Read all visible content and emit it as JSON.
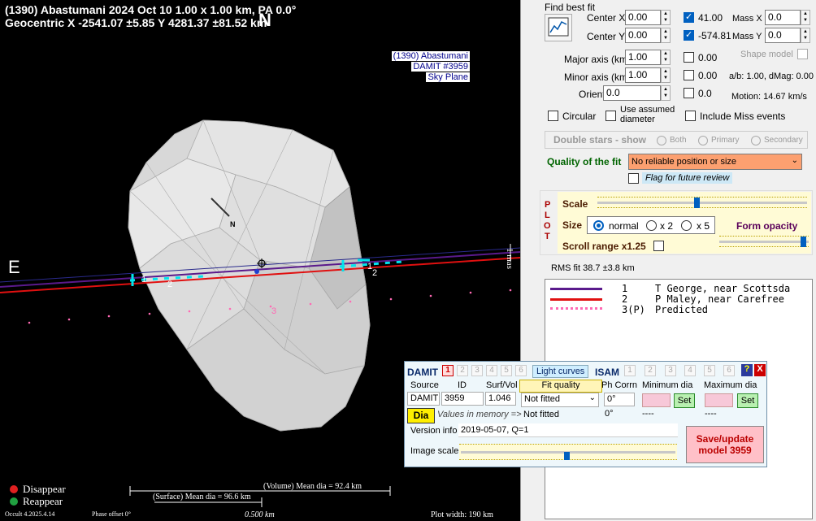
{
  "plot": {
    "title_line1": "(1390) Abastumani  2024 Oct 10  1.00 x 1.00 km, PA 0.0°",
    "title_line2": "Geocentric  X  -2541.07 ±5.85  Y 4281.37 ±81.52 km",
    "north_label": "N",
    "east_label": "E",
    "asteroid_north_label": "N",
    "info_box": [
      "(1390) Abastumani",
      "DAMIT #3959",
      "Sky Plane"
    ],
    "mas_label": "1 mas",
    "chord_labels": [
      "2",
      "2",
      "1",
      "1",
      "3"
    ],
    "legend_disappear": "Disappear",
    "legend_reappear": "Reappear",
    "version": "Occult 4.2025.4.14",
    "phase_offset": "Phase offset 0°",
    "volume_mean": "(Volume) Mean dia = 92.4 km",
    "surface_mean": "(Surface) Mean dia = 96.6 km",
    "scale_bar": "0.500 km",
    "plot_width": "Plot width: 190 km",
    "colors": {
      "disappear": "#e02020",
      "reappear": "#20a040",
      "chord1": "#5a1a8c",
      "chord2": "#e01010",
      "chord3": "#ff69b4",
      "cyan": "#00e5ee"
    }
  },
  "panel": {
    "find_best_fit": "Find best fit",
    "center_x_label": "Center X",
    "center_x_value": "0.00",
    "center_x_fit_value": "41.00",
    "center_y_label": "Center Y",
    "center_y_value": "0.00",
    "center_y_fit_value": "-574.81",
    "mass_x_label": "Mass X",
    "mass_x_value": "0.0",
    "mass_y_label": "Mass Y",
    "mass_y_value": "0.0",
    "shape_model_label": "Shape model",
    "major_axis_label": "Major axis (km)",
    "major_axis_value": "1.00",
    "major_axis_fit": "0.00",
    "minor_axis_label": "Minor axis (km)",
    "minor_axis_value": "1.00",
    "minor_axis_fit": "0.00",
    "ab_dmag": "a/b: 1.00, dMag: 0.00",
    "orientation_label": "Orientation",
    "orientation_value": "0.0",
    "orientation_fit": "0.0",
    "motion": "Motion: 14.67 km/s",
    "circular_label": "Circular",
    "use_assumed_label": "Use assumed diameter",
    "include_miss_label": "Include Miss events",
    "double_stars_label": "Double stars - show",
    "radio_both": "Both",
    "radio_primary": "Primary",
    "radio_secondary": "Secondary",
    "quality_label": "Quality of the fit",
    "quality_value": "No reliable position or size",
    "flag_review_label": "Flag for future review",
    "plot_vertical": [
      "P",
      "L",
      "O",
      "T"
    ],
    "scale_label": "Scale",
    "size_label": "Size",
    "size_normal": "normal",
    "size_x2": "x 2",
    "size_x5": "x 5",
    "form_opacity_label": "Form opacity",
    "scroll_range_label": "Scroll range x1.25",
    "rms_fit": "RMS fit 38.7 ±3.8 km",
    "observers": [
      {
        "num": "1",
        "text": "T George, near Scottsda"
      },
      {
        "num": "2",
        "text": "P Maley, near Carefree"
      },
      {
        "num": "3(P)",
        "text": "Predicted"
      }
    ]
  },
  "damit": {
    "title": "DAMIT",
    "tabs": [
      "1",
      "2",
      "3",
      "4",
      "5",
      "6"
    ],
    "light_curves": "Light curves",
    "isam": "ISAM",
    "isam_tabs": [
      "1",
      "2",
      "3",
      "4",
      "5",
      "6"
    ],
    "help": "?",
    "close": "X",
    "source_label": "Source",
    "id_label": "ID",
    "surf_vol_label": "Surf/Vol",
    "fit_quality_label": "Fit quality",
    "ph_corrn_label": "Ph Corrn",
    "min_dia_label": "Minimum dia",
    "max_dia_label": "Maximum dia",
    "source_value": "DAMIT",
    "id_value": "3959",
    "surf_vol_value": "1.046",
    "fit_quality_value": "Not fitted",
    "ph_corrn_value": "0°",
    "set_label": "Set",
    "dia_button": "Dia",
    "values_in_memory": "Values in memory =>",
    "mem_fit_quality": "Not fitted",
    "mem_ph": "0°",
    "mem_min": "----",
    "mem_max": "----",
    "version_info_label": "Version info",
    "version_info_value": "2019-05-07, Q=1",
    "image_scale_label": "Image scale",
    "save_update": "Save/update model 3959"
  }
}
